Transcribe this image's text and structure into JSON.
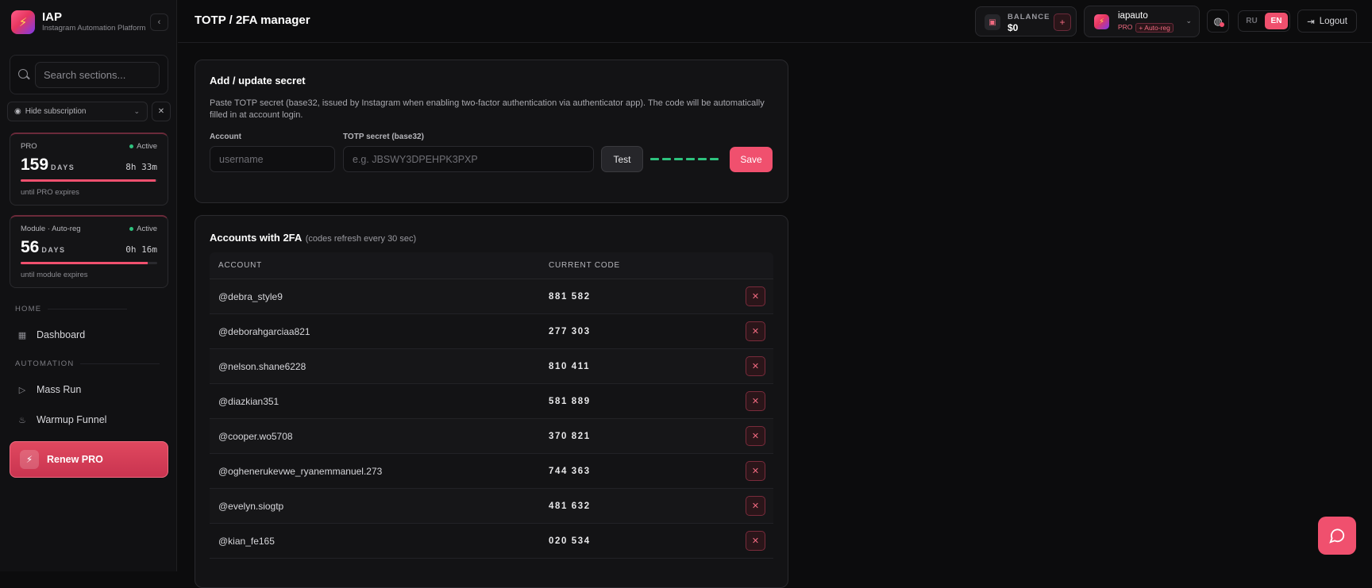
{
  "brand": {
    "title": "IAP",
    "subtitle": "Instagram Automation Platform",
    "logo_icon": "bolt-icon"
  },
  "sidebar": {
    "search_placeholder": "Search sections...",
    "hide_subscription_label": "Hide subscription",
    "subscriptions": [
      {
        "name": "PRO",
        "status": "Active",
        "days": "159",
        "days_label": "DAYS",
        "time": "8h 33m",
        "footer": "until PRO expires",
        "progress": 0.99
      },
      {
        "name": "Module · Auto-reg",
        "status": "Active",
        "days": "56",
        "days_label": "DAYS",
        "time": "0h 16m",
        "footer": "until module expires",
        "progress": 0.93
      }
    ],
    "sections": [
      {
        "title": "HOME",
        "items": [
          {
            "label": "Dashboard",
            "icon": "grid-icon"
          }
        ]
      },
      {
        "title": "AUTOMATION",
        "items": [
          {
            "label": "Mass Run",
            "icon": "play-icon"
          },
          {
            "label": "Warmup Funnel",
            "icon": "flame-icon"
          }
        ]
      }
    ],
    "renew_label": "Renew PRO"
  },
  "header": {
    "title": "TOTP / 2FA manager",
    "balance_label": "BALANCE",
    "balance_value": "$0",
    "add_balance": "+",
    "user_name": "iapauto",
    "user_plan": "PRO",
    "user_module": "+ Auto-reg",
    "lang_ru": "RU",
    "lang_en": "EN",
    "logout_label": "Logout"
  },
  "add_secret": {
    "title": "Add / update secret",
    "description": "Paste TOTP secret (base32, issued by Instagram when enabling two-factor authentication via authenticator app). The code will be automatically filled in at account login.",
    "account_label": "Account",
    "account_placeholder": "username",
    "secret_label": "TOTP secret (base32)",
    "secret_placeholder": "e.g. JBSWY3DPEHPK3PXP",
    "test_label": "Test",
    "save_label": "Save"
  },
  "accounts": {
    "title": "Accounts with 2FA",
    "hint": "(codes refresh every 30 sec)",
    "col_account": "ACCOUNT",
    "col_code": "CURRENT CODE",
    "delete_symbol": "✕",
    "rows": [
      {
        "account": "@debra_style9",
        "code": "881582"
      },
      {
        "account": "@deborahgarciaa821",
        "code": "277303"
      },
      {
        "account": "@nelson.shane6228",
        "code": "810411"
      },
      {
        "account": "@diazkian351",
        "code": "581889"
      },
      {
        "account": "@cooper.wo5708",
        "code": "370821"
      },
      {
        "account": "@oghenerukevwe_ryanemmanuel.273",
        "code": "744363"
      },
      {
        "account": "@evelyn.siogtp",
        "code": "481632"
      },
      {
        "account": "@kian_fe165",
        "code": "020534"
      }
    ]
  },
  "colors": {
    "accent": "#f0506e",
    "success": "#2ec27e",
    "background": "#0c0c0d"
  }
}
